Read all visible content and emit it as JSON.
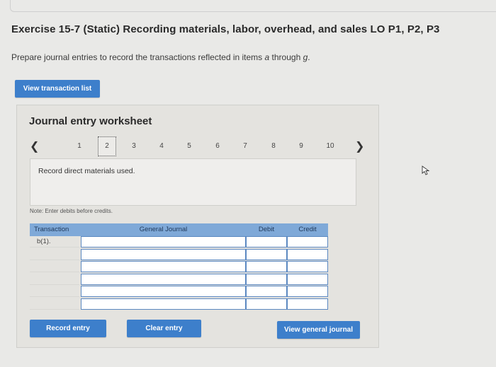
{
  "page": {
    "title": "Exercise 15-7 (Static) Recording materials, labor, overhead, and sales LO P1, P2, P3",
    "instructions_prefix": "Prepare journal entries to record the transactions reflected in items ",
    "instructions_a": "a",
    "instructions_mid": " through ",
    "instructions_g": "g",
    "instructions_end": "."
  },
  "buttons": {
    "view_transaction_list": "View transaction list",
    "record_entry": "Record entry",
    "clear_entry": "Clear entry",
    "view_general_journal": "View general journal"
  },
  "worksheet": {
    "title": "Journal entry worksheet",
    "pages": [
      "1",
      "2",
      "3",
      "4",
      "5",
      "6",
      "7",
      "8",
      "9",
      "10"
    ],
    "active_page": "2",
    "entry_prompt": "Record direct materials used.",
    "note": "Note: Enter debits before credits."
  },
  "journal": {
    "headers": {
      "transaction": "Transaction",
      "general_journal": "General Journal",
      "debit": "Debit",
      "credit": "Credit"
    },
    "rows": [
      {
        "transaction": "b(1)."
      },
      {
        "transaction": ""
      },
      {
        "transaction": ""
      },
      {
        "transaction": ""
      },
      {
        "transaction": ""
      },
      {
        "transaction": ""
      }
    ]
  },
  "colors": {
    "button": "#3d7fcb",
    "table_header": "#7fa9d8",
    "cell_border": "#5b88c1"
  },
  "icons": {
    "prev": "chevron-left-icon",
    "next": "chevron-right-icon",
    "cursor": "mouse-pointer-icon"
  }
}
